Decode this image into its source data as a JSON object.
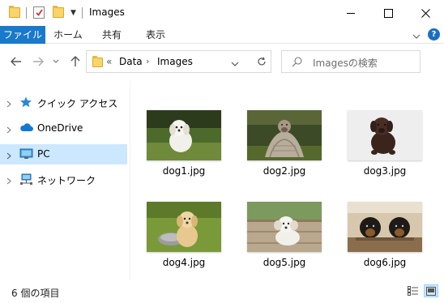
{
  "window": {
    "title": "Images",
    "controls": {
      "minimize": "—",
      "maximize": "☐",
      "close": "✕"
    }
  },
  "ribbon": {
    "tabs": [
      "ファイル",
      "ホーム",
      "共有",
      "表示"
    ],
    "help": "?"
  },
  "address": {
    "overflow": "«",
    "crumbs": [
      "Data",
      "Images"
    ],
    "separator": "›"
  },
  "search": {
    "placeholder": "Imagesの検索"
  },
  "nav_pane": {
    "items": [
      {
        "label": "クイック アクセス",
        "icon": "star-icon"
      },
      {
        "label": "OneDrive",
        "icon": "cloud-icon"
      },
      {
        "label": "PC",
        "icon": "computer-icon",
        "selected": true
      },
      {
        "label": "ネットワーク",
        "icon": "network-icon"
      }
    ]
  },
  "files": [
    {
      "name": "dog1.jpg",
      "thumbnail": "white puppy on grass"
    },
    {
      "name": "dog2.jpg",
      "thumbnail": "dog in blanket on grass"
    },
    {
      "name": "dog3.jpg",
      "thumbnail": "brown puppy on white floor"
    },
    {
      "name": "dog4.jpg",
      "thumbnail": "golden puppy with bowl"
    },
    {
      "name": "dog5.jpg",
      "thumbnail": "white puppy on wood"
    },
    {
      "name": "dog6.jpg",
      "thumbnail": "two rottweiler puppies"
    }
  ],
  "status": {
    "item_count": "6 個の項目"
  },
  "colors": {
    "accent": "#1979ca",
    "selection": "#cce8ff"
  }
}
